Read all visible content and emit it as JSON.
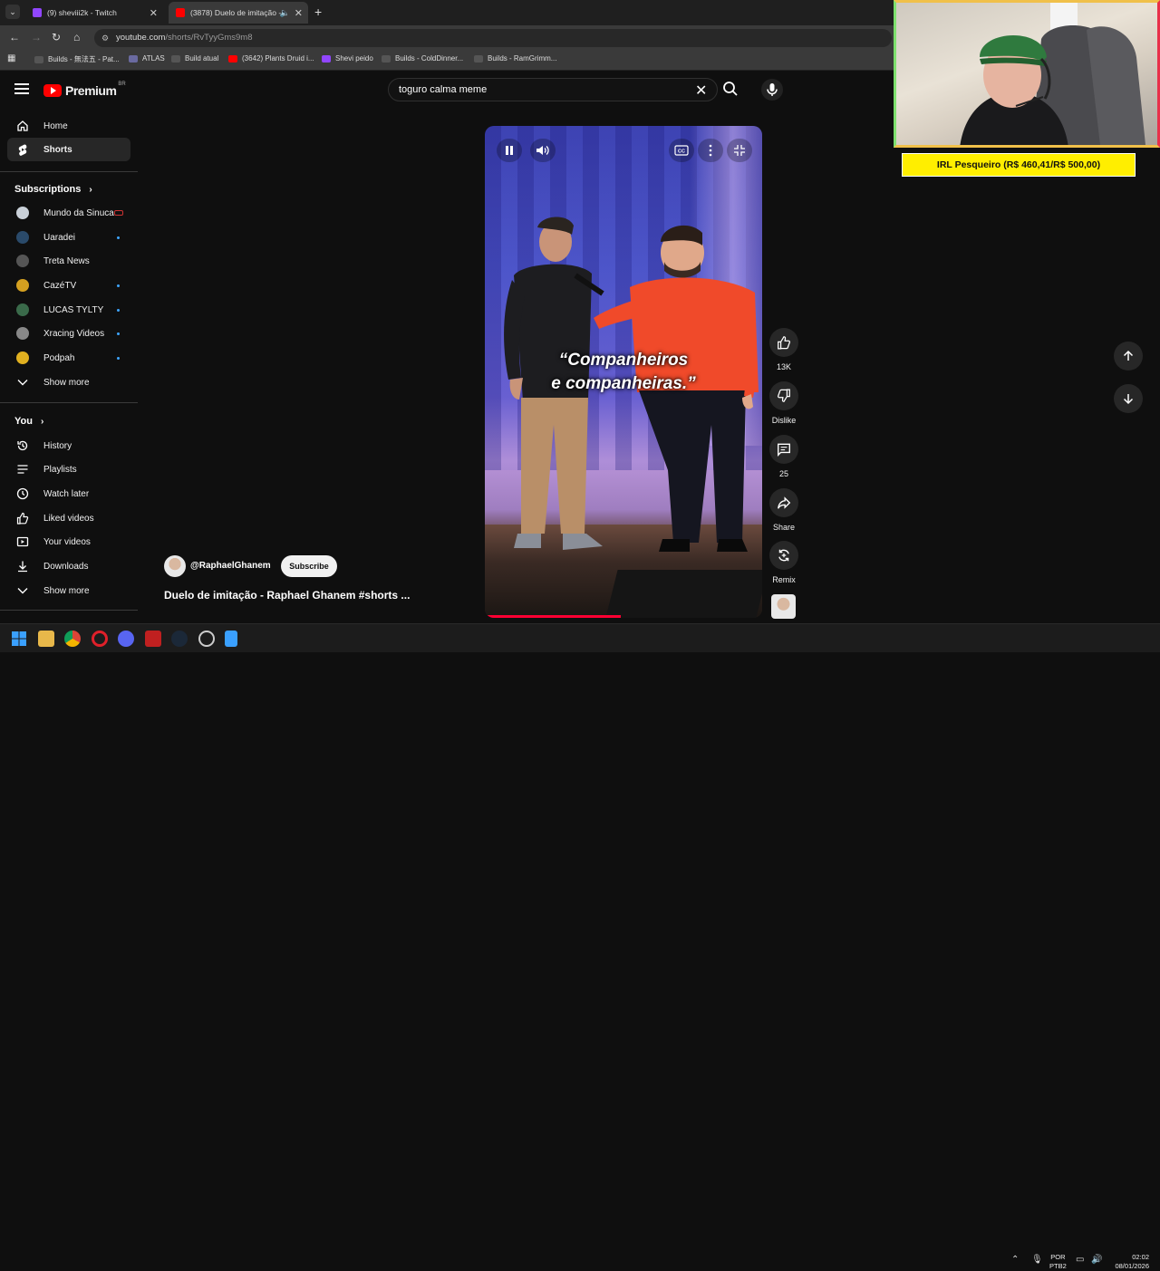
{
  "browser": {
    "tabs": [
      {
        "title": "(9) sheviii2k - Twitch"
      },
      {
        "title": "(3878) Duelo de imitação -"
      }
    ],
    "url_host": "youtube.com",
    "url_path": "/shorts/RvTyyGms9m8",
    "bookmarks": [
      "Builds - 無法五 - Pat...",
      "ATLAS",
      "Build atual",
      "(3642) Plants Druid i...",
      "Shevi peido",
      "Builds - ColdDinner...",
      "Builds - RamGrimm..."
    ]
  },
  "header": {
    "logo": "Premium",
    "country": "BR",
    "search_value": "toguro calma meme"
  },
  "sidebar": {
    "nav": [
      {
        "label": "Home",
        "icon": "home-icon"
      },
      {
        "label": "Shorts",
        "icon": "shorts-icon"
      }
    ],
    "subscriptions_header": "Subscriptions",
    "subscriptions": [
      {
        "label": "Mundo da Sinuca",
        "color": "#cc3333",
        "indicator": "live"
      },
      {
        "label": "Uaradei",
        "color": "#2a4a6a",
        "indicator": "dot"
      },
      {
        "label": "Treta News",
        "color": "#555555",
        "indicator": ""
      },
      {
        "label": "CazéTV",
        "color": "#d4a020",
        "indicator": "dot"
      },
      {
        "label": "LUCAS TYLTY",
        "color": "#3a6a4a",
        "indicator": "dot"
      },
      {
        "label": "Xracing Videos",
        "color": "#888888",
        "indicator": "dot"
      },
      {
        "label": "Podpah",
        "color": "#e0b020",
        "indicator": "dot"
      }
    ],
    "show_more_1": "Show more",
    "you_header": "You",
    "you_items": [
      {
        "label": "History",
        "icon": "history-icon"
      },
      {
        "label": "Playlists",
        "icon": "playlists-icon"
      },
      {
        "label": "Watch later",
        "icon": "watch-later-icon"
      },
      {
        "label": "Liked videos",
        "icon": "thumbs-up-icon"
      },
      {
        "label": "Your videos",
        "icon": "your-videos-icon"
      },
      {
        "label": "Downloads",
        "icon": "download-icon"
      }
    ],
    "show_more_2": "Show more"
  },
  "video": {
    "caption_line1": "“Companheiros",
    "caption_line2": "e companheiras.”",
    "progress": 0.49,
    "channel": "@RaphaelGhanem",
    "subscribe": "Subscribe",
    "title": "Duelo de imitação - Raphael Ghanem #shorts ..."
  },
  "actions": {
    "likes": "13K",
    "dislike": "Dislike",
    "comments": "25",
    "share": "Share",
    "remix": "Remix"
  },
  "overlay": {
    "goal": "IRL Pesqueiro (R$ 460,41/R$ 500,00)"
  },
  "taskbar": {
    "lang1": "POR",
    "lang2": "PTB2",
    "time": "02:02",
    "date": "08/01/2026"
  }
}
